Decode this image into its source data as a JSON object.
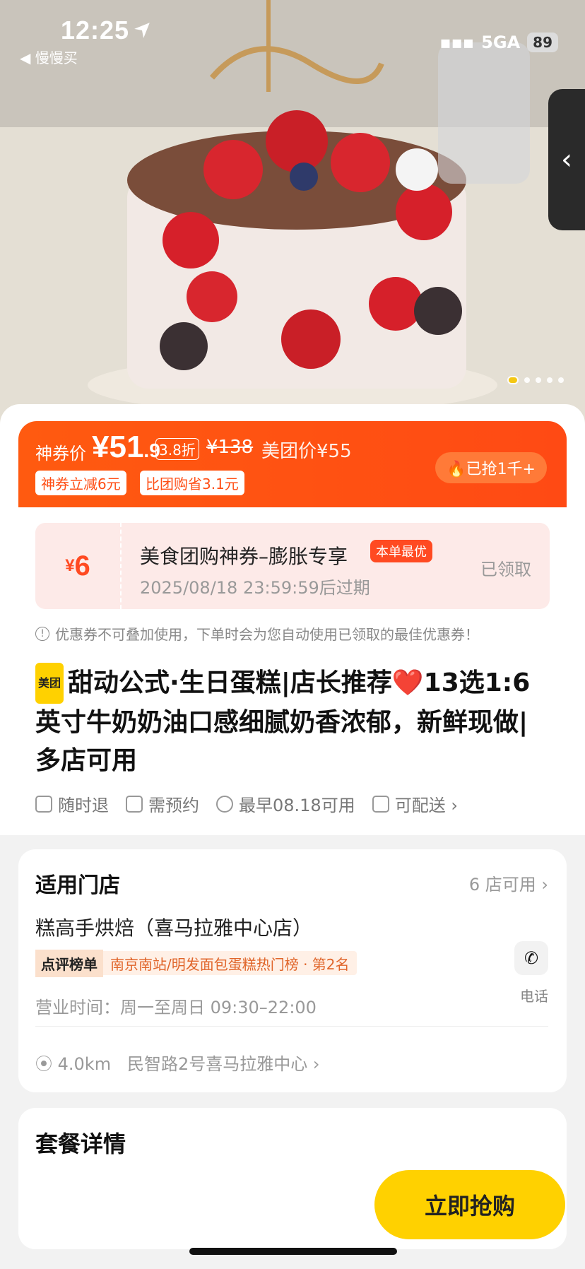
{
  "status": {
    "time": "12:25",
    "back_app": "◀ 慢慢买",
    "network": "5GA",
    "battery": "89"
  },
  "hero": {
    "side_tab_icon": "chevron-left"
  },
  "price_banner": {
    "label": "神券价",
    "price": "¥51",
    "price_decimal": ".9",
    "discount": "3.8折",
    "original": "¥138",
    "meituan_price": "美团价¥55",
    "tag1": "神券立减6元",
    "tag2": "比团购省3.1元",
    "grabbed": "已抢1千+"
  },
  "coupon": {
    "amount_symbol": "¥",
    "amount": "6",
    "title": "美食团购神券–膨胀专享",
    "best_tag": "本单最优",
    "expiry": "2025/08/18 23:59:59后过期",
    "status": "已领取"
  },
  "notice": "优惠券不可叠加使用，下单时会为您自动使用已领取的最佳优惠券！",
  "product": {
    "brand_chip": "美团",
    "title": "甜动公式·生日蛋糕|店长推荐❤️13选1:6英寸牛奶奶油口感细腻奶香浓郁，新鲜现做|多店可用",
    "features": [
      "随时退",
      "需预约",
      "最早08.18可用",
      "可配送 ›"
    ]
  },
  "store": {
    "section_title": "适用门店",
    "count": "6 店可用 ›",
    "name": "糕高手烘焙（喜马拉雅中心店）",
    "rank_badge": "点评榜单",
    "rank_text": "南京南站/明发面包蛋糕热门榜 · 第2名",
    "hours": "营业时间：周一至周日 09:30–22:00",
    "phone_label": "电话",
    "distance": "4.0km",
    "address": "民智路2号喜马拉雅中心 ›"
  },
  "package": {
    "title": "套餐详情"
  },
  "buy_button": "立即抢购"
}
